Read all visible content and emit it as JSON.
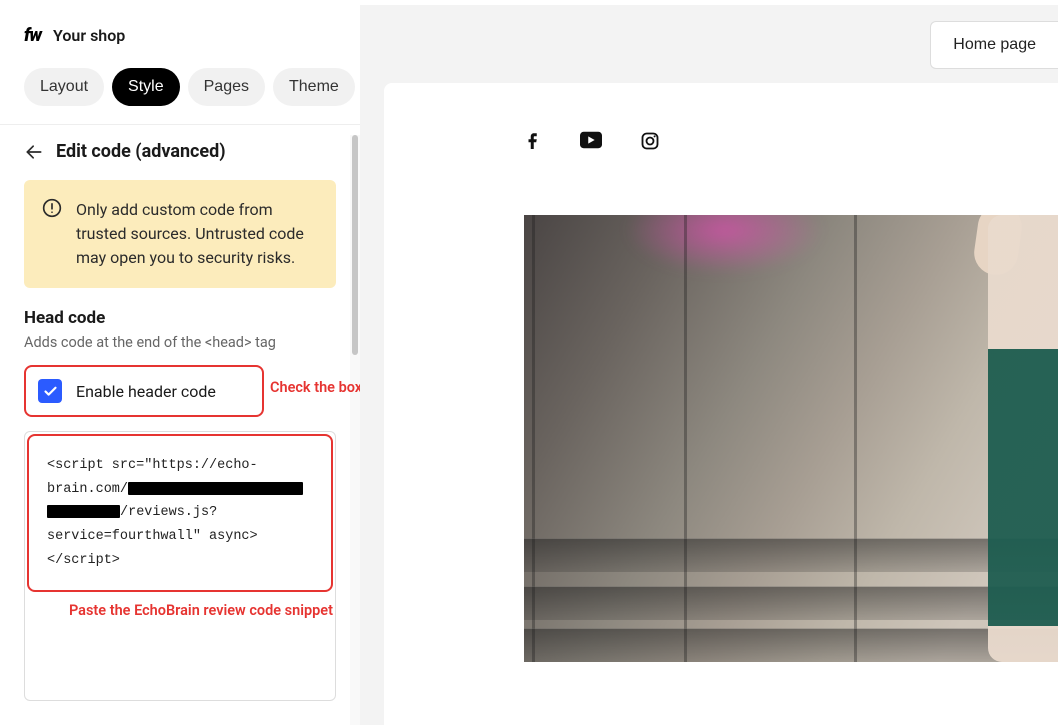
{
  "app": {
    "logo_text": "fw",
    "shop_title": "Your shop"
  },
  "tabs": {
    "layout": "Layout",
    "style": "Style",
    "pages": "Pages",
    "theme": "Theme"
  },
  "style_panel": {
    "title": "Edit code (advanced)",
    "warning": "Only add custom code from trusted sources. Untrusted code may open you to security risks.",
    "head_code_heading": "Head code",
    "head_code_sub": "Adds code at the end of the <head> tag",
    "enable_header_label": "Enable header code",
    "code": {
      "line1": "<script src=\"https://echo-",
      "line2_pre": "brain.com/",
      "line3_post": "/reviews.js?",
      "line4": "service=fourthwall\" async>",
      "line5": "</script>"
    },
    "annotation_check": "Check the box",
    "annotation_paste": "Paste the EchoBrain review code snippet"
  },
  "preview": {
    "home_button": "Home page"
  },
  "icons": {
    "back": "arrow-left",
    "alert": "alert-circle",
    "check": "check",
    "facebook": "facebook",
    "youtube": "youtube",
    "instagram": "instagram"
  }
}
